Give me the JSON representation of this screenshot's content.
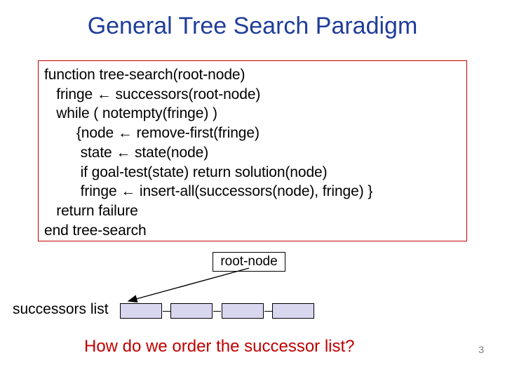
{
  "title": "General Tree Search Paradigm",
  "code": {
    "l1": "function tree-search(root-node)",
    "l2": "   fringe ← successors(root-node)",
    "l3": "   while ( notempty(fringe) )",
    "l4": "        {node ← remove-first(fringe)",
    "l5": "         state ← state(node)",
    "l6": "         if goal-test(state) return solution(node)",
    "l7": "         fringe ← insert-all(successors(node), fringe) }",
    "l8": "   return failure",
    "l9": "end tree-search"
  },
  "root_label": "root-node",
  "successors_label": "successors list",
  "question": "How do we order the successor list?",
  "page_number": "3"
}
